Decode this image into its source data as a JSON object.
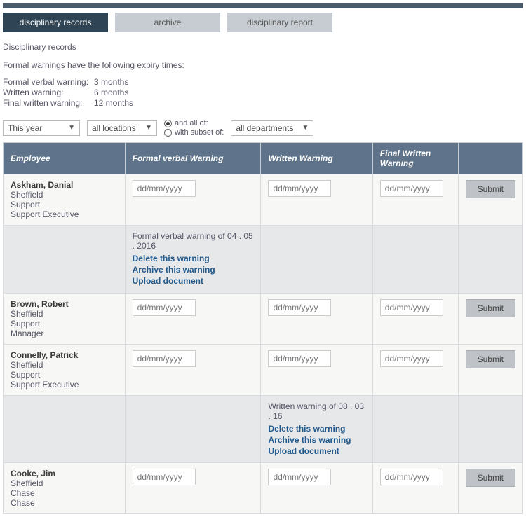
{
  "tabs": [
    {
      "label": "disciplinary records",
      "active": true
    },
    {
      "label": "archive",
      "active": false
    },
    {
      "label": "disciplinary report",
      "active": false
    }
  ],
  "section_title": "Disciplinary records",
  "intro": "Formal warnings have the following expiry times:",
  "expiry": [
    {
      "label": "Formal verbal warning:",
      "value": "3 months"
    },
    {
      "label": "Written warning:",
      "value": "6 months"
    },
    {
      "label": "Final written warning:",
      "value": "12 months"
    }
  ],
  "filters": {
    "period": "This year",
    "location": "all locations",
    "radio1": "and all of:",
    "radio2": "with subset of:",
    "department": "all departments"
  },
  "columns": {
    "employee": "Employee",
    "fvw": "Formal verbal Warning",
    "ww": "Written Warning",
    "fww": "Final Written Warning"
  },
  "date_placeholder": "dd/mm/yyyy",
  "submit_label": "Submit",
  "detail_actions": {
    "delete": "Delete this warning",
    "archive": "Archive this warning",
    "upload": "Upload document"
  },
  "rows": [
    {
      "name": "Askham, Danial",
      "loc": "Sheffield",
      "dept": "Support",
      "role": "Support Executive",
      "detail_col": "fvw",
      "detail_text": "Formal verbal warning of 04 . 05 . 2016"
    },
    {
      "name": "Brown, Robert",
      "loc": "Sheffield",
      "dept": "Support",
      "role": "Manager",
      "detail_col": null,
      "detail_text": ""
    },
    {
      "name": "Connelly, Patrick",
      "loc": "Sheffield",
      "dept": "Support",
      "role": "Support Executive",
      "detail_col": "ww",
      "detail_text": "Written warning of 08 . 03 . 16"
    },
    {
      "name": "Cooke, Jim",
      "loc": "Sheffield",
      "dept": "Chase",
      "role": "Chase",
      "detail_col": null,
      "detail_text": ""
    }
  ]
}
